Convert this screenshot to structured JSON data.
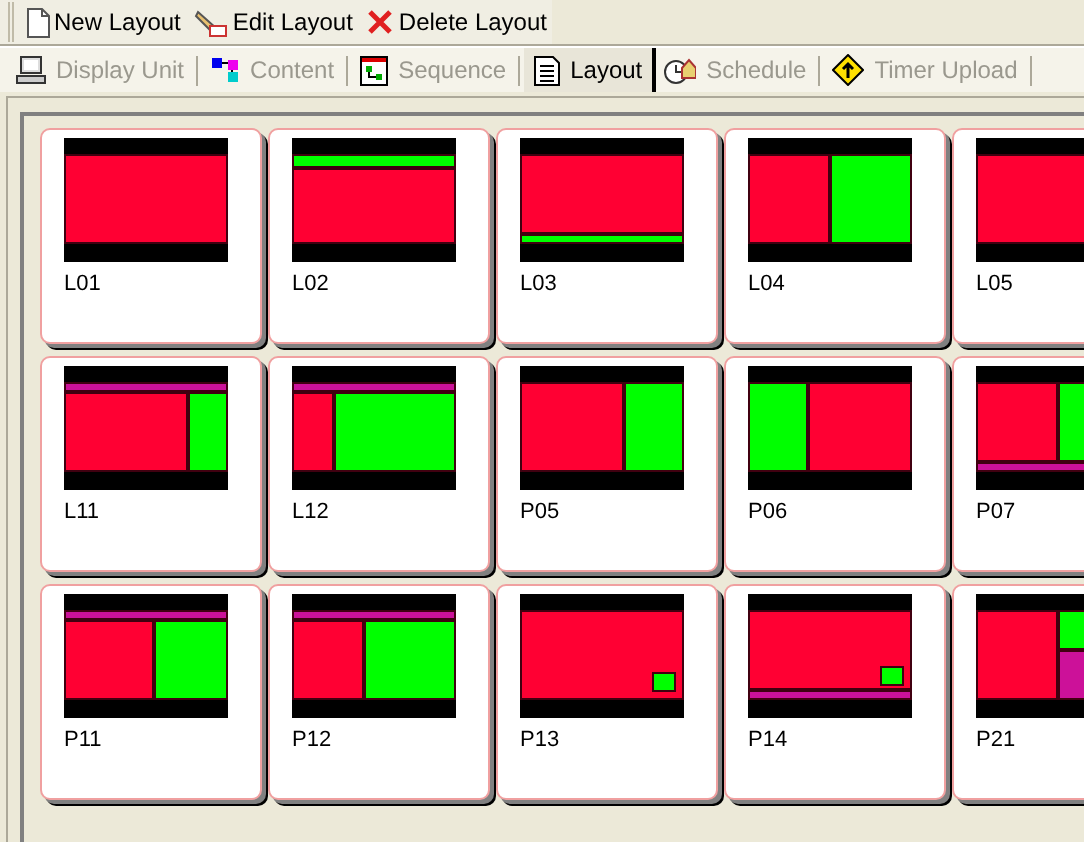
{
  "toolbar": [
    {
      "label": "New Layout",
      "kind": "new"
    },
    {
      "label": "Edit Layout",
      "kind": "edit"
    },
    {
      "label": "Delete Layout",
      "kind": "delete"
    }
  ],
  "tabs": [
    {
      "label": "Display Unit",
      "kind": "monitor",
      "selected": false
    },
    {
      "label": "Content",
      "kind": "content",
      "selected": false
    },
    {
      "label": "Sequence",
      "kind": "sequence",
      "selected": false
    },
    {
      "label": "Layout",
      "kind": "layout",
      "selected": true
    },
    {
      "label": "Schedule",
      "kind": "schedule",
      "selected": false
    },
    {
      "label": "Timer Upload",
      "kind": "upload",
      "selected": false
    }
  ],
  "layouts": [
    {
      "name": "L01",
      "kind": "full",
      "regions": [
        {
          "color": "#ff0033"
        }
      ]
    },
    {
      "name": "L02",
      "kind": "topstrip",
      "regions": [
        {
          "color": "#00ff00"
        },
        {
          "color": "#ff0033"
        }
      ]
    },
    {
      "name": "L03",
      "kind": "bottomstrip",
      "regions": [
        {
          "color": "#ff0033"
        },
        {
          "color": "#00ff00"
        }
      ]
    },
    {
      "name": "L04",
      "kind": "halves",
      "regions": [
        {
          "color": "#ff0033"
        },
        {
          "color": "#00ff00"
        }
      ]
    },
    {
      "name": "L05",
      "kind": "full",
      "regions": [
        {
          "color": "#ff0033"
        }
      ]
    },
    {
      "name": "L11",
      "kind": "stripwide",
      "regions": [
        {
          "color": "#cc1199"
        },
        {
          "color": "#ff0033"
        },
        {
          "color": "#00ff00"
        }
      ]
    },
    {
      "name": "L12",
      "kind": "stripnarrow",
      "regions": [
        {
          "color": "#cc1199"
        },
        {
          "color": "#ff0033"
        },
        {
          "color": "#00ff00"
        }
      ]
    },
    {
      "name": "P05",
      "kind": "wide",
      "regions": [
        {
          "color": "#ff0033"
        },
        {
          "color": "#00ff00"
        }
      ]
    },
    {
      "name": "P06",
      "kind": "narrow",
      "regions": [
        {
          "color": "#00ff00"
        },
        {
          "color": "#ff0033"
        }
      ]
    },
    {
      "name": "P07",
      "kind": "splitfooter",
      "regions": [
        {
          "color": "#ff0033"
        },
        {
          "color": "#00ff00"
        },
        {
          "color": "#cc1199"
        }
      ]
    },
    {
      "name": "P11",
      "kind": "stripmidwide",
      "regions": [
        {
          "color": "#cc1199"
        },
        {
          "color": "#ff0033"
        },
        {
          "color": "#00ff00"
        }
      ]
    },
    {
      "name": "P12",
      "kind": "stripmidnarrow",
      "regions": [
        {
          "color": "#cc1199"
        },
        {
          "color": "#ff0033"
        },
        {
          "color": "#00ff00"
        }
      ]
    },
    {
      "name": "P13",
      "kind": "inset",
      "regions": [
        {
          "color": "#ff0033"
        },
        {
          "color": "#00ff00"
        }
      ]
    },
    {
      "name": "P14",
      "kind": "insetfooter",
      "regions": [
        {
          "color": "#ff0033"
        },
        {
          "color": "#00ff00"
        },
        {
          "color": "#cc1199"
        }
      ]
    },
    {
      "name": "P21",
      "kind": "leftstack",
      "regions": [
        {
          "color": "#ff0033"
        },
        {
          "color": "#00ff00"
        },
        {
          "color": "#cc1199"
        }
      ]
    }
  ]
}
